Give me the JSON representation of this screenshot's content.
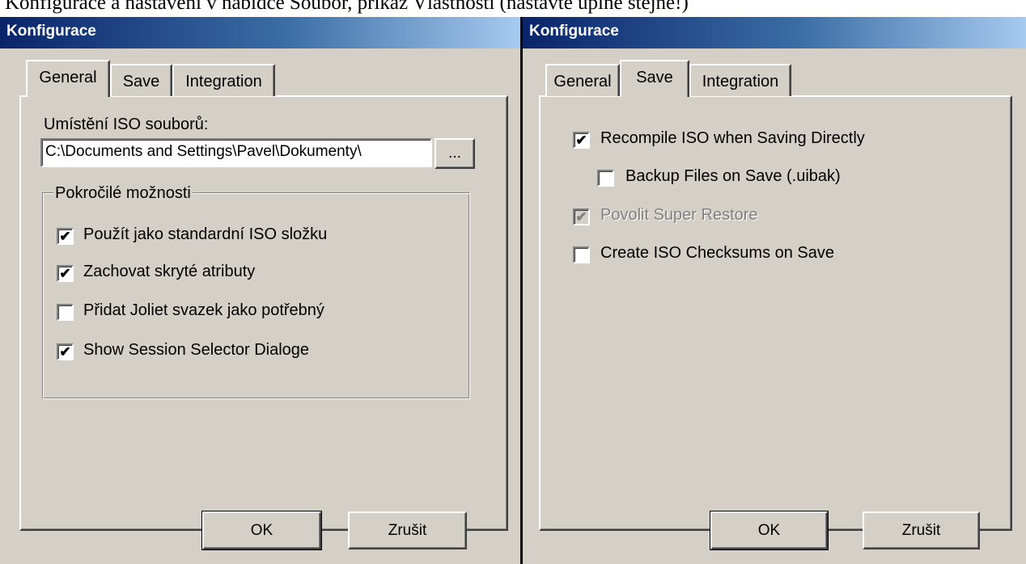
{
  "caption": "Konfigurace a nastavení v nabídce Soubor, příkaz Vlastnosti (nastavte úplně stejně!)",
  "left_dialog": {
    "title": "Konfigurace",
    "tabs": [
      "General",
      "Save",
      "Integration"
    ],
    "active_tab": "General",
    "location_label": "Umístění ISO souborů:",
    "location_value": "C:\\Documents and Settings\\Pavel\\Dokumenty\\",
    "browse_label": "...",
    "group_label": "Pokročilé možnosti",
    "options": [
      {
        "label": "Použít jako standardní ISO složku",
        "checked": true
      },
      {
        "label": "Zachovat skryté atributy",
        "checked": true
      },
      {
        "label": "Přidat Joliet svazek jako potřebný",
        "checked": false
      },
      {
        "label": "Show Session Selector Dialoge",
        "checked": true
      }
    ],
    "ok_label": "OK",
    "cancel_label": "Zrušit"
  },
  "right_dialog": {
    "title": "Konfigurace",
    "tabs": [
      "General",
      "Save",
      "Integration"
    ],
    "active_tab": "Save",
    "options": [
      {
        "label": "Recompile ISO when Saving Directly",
        "checked": true,
        "disabled": false
      },
      {
        "label": "Backup Files on Save (.uibak)",
        "checked": false,
        "disabled": false
      },
      {
        "label": "Povolit Super Restore",
        "checked": true,
        "disabled": true
      },
      {
        "label": "Create ISO Checksums on Save",
        "checked": false,
        "disabled": false
      }
    ],
    "ok_label": "OK",
    "cancel_label": "Zrušit"
  }
}
